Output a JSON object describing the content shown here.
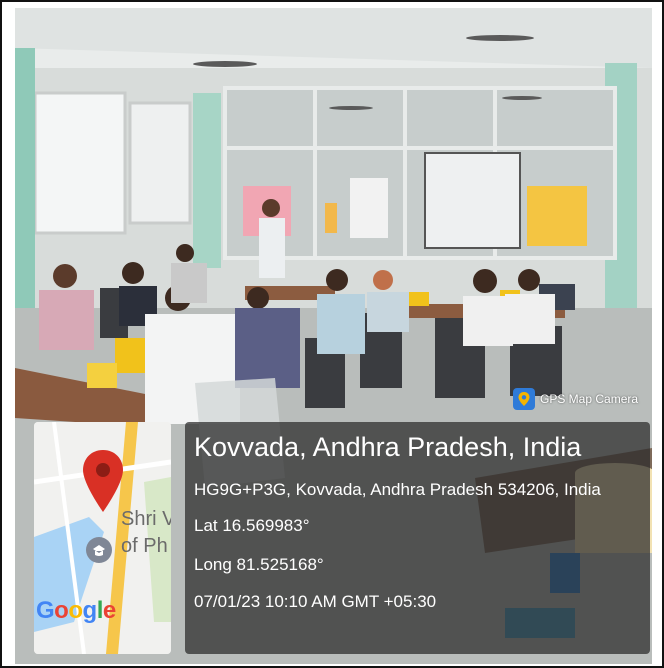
{
  "stamp": {
    "label": "GPS Map Camera",
    "icon": "gps-map-camera-icon"
  },
  "location": {
    "place": "Kovvada, Andhra Pradesh, India",
    "address": "HG9G+P3G, Kovvada, Andhra Pradesh 534206, India",
    "lat": "Lat 16.569983°",
    "long": "Long 81.525168°",
    "datetime": "07/01/23 10:10 AM GMT +05:30"
  },
  "map": {
    "label_line1": "Shri V",
    "label_line2": "of Ph",
    "logo": {
      "g1": "G",
      "o1": "o",
      "o2": "o",
      "g2": "g",
      "l": "l",
      "e": "e"
    },
    "pin_color": "#d93025"
  },
  "colors": {
    "overlay": "#282828",
    "google_blue": "#4285f4",
    "google_red": "#ea4335",
    "google_yellow": "#fbbc05",
    "google_green": "#34a853"
  }
}
